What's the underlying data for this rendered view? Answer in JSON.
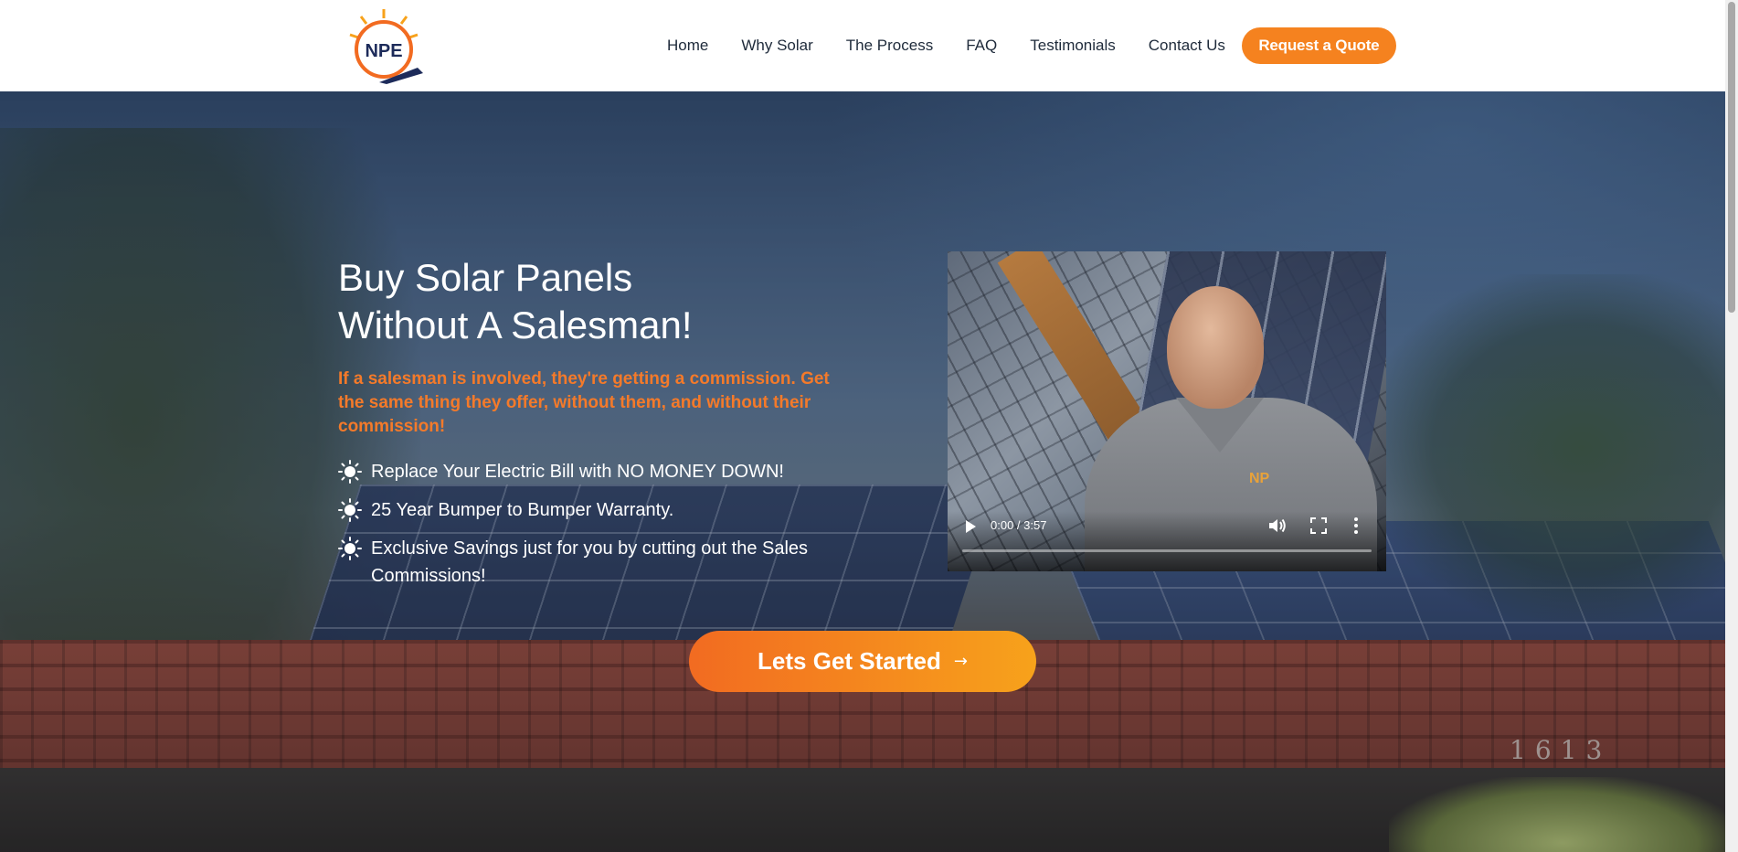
{
  "header": {
    "logo_text": "NPE",
    "nav": [
      "Home",
      "Why Solar",
      "The Process",
      "FAQ",
      "Testimonials",
      "Contact Us"
    ],
    "cta_label": "Request a Quote"
  },
  "hero": {
    "headline_line1": "Buy Solar Panels",
    "headline_line2": "Without A Salesman!",
    "subhead": "If a salesman is involved, they're getting a commission. Get the same thing they offer, without them, and without their commission!",
    "bullets": [
      "Replace Your Electric Bill with NO MONEY DOWN!",
      "25 Year Bumper to Bumper Warranty.",
      "Exclusive Savings just for you by cutting out the Sales Commissions!"
    ],
    "bullet_icon": "sun-icon",
    "house_number": "1613",
    "cta_label": "Lets Get Started",
    "cta_arrow": "→"
  },
  "video": {
    "time": "0:00 / 3:57",
    "shirt_logo": "NP",
    "progress": 0
  },
  "colors": {
    "accent": "#f5821f",
    "subhead": "#f47a2a",
    "nav_text": "#1e2a3a"
  }
}
